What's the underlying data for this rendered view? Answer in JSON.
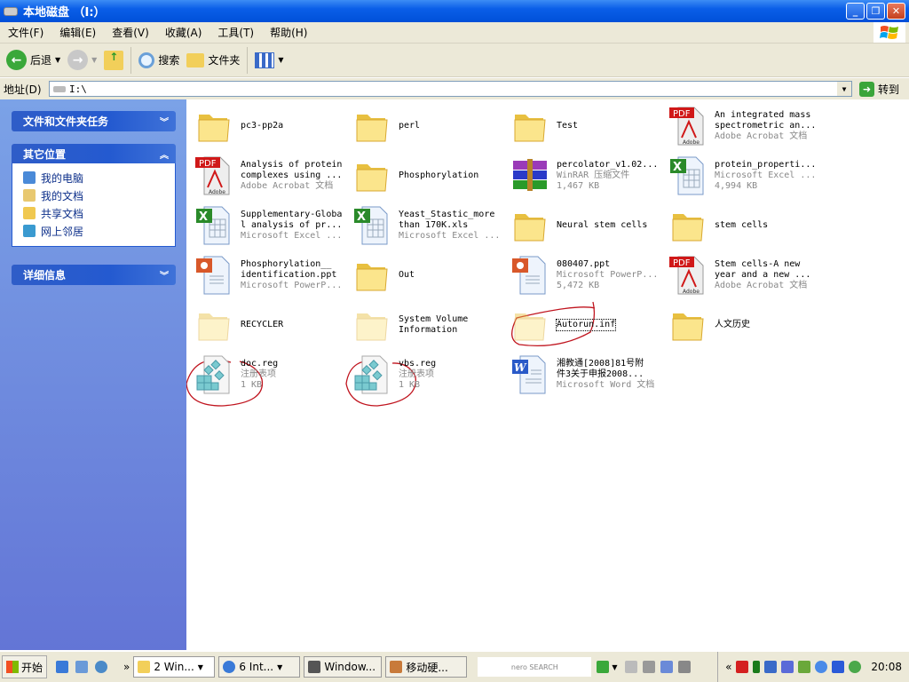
{
  "window": {
    "title": "本地磁盘 （I:）",
    "minimize": "_",
    "maximize": "❐",
    "close": "✕"
  },
  "menu": [
    "文件(F)",
    "编辑(E)",
    "查看(V)",
    "收藏(A)",
    "工具(T)",
    "帮助(H)"
  ],
  "toolbar": {
    "back": "后退",
    "search": "搜索",
    "folders": "文件夹"
  },
  "address": {
    "label": "地址(D)",
    "value": "I:\\",
    "go": "转到"
  },
  "sidebar": {
    "tasks_title": "文件和文件夹任务",
    "other_title": "其它位置",
    "other_items": [
      {
        "label": "我的电脑",
        "color": "#4a8ad8"
      },
      {
        "label": "我的文档",
        "color": "#e8c870"
      },
      {
        "label": "共享文档",
        "color": "#f0c850"
      },
      {
        "label": "网上邻居",
        "color": "#3a9ad0"
      }
    ],
    "details_title": "详细信息"
  },
  "files": [
    {
      "name": "pc3-pp2a",
      "icon": "folder"
    },
    {
      "name": "perl",
      "icon": "folder"
    },
    {
      "name": "Test",
      "icon": "folder"
    },
    {
      "name": "An integrated mass\nspectrometric an...",
      "type": "Adobe Acrobat 文档",
      "icon": "pdf"
    },
    {
      "name": "Analysis of protein\ncomplexes using ...",
      "type": "Adobe Acrobat 文档",
      "icon": "pdf"
    },
    {
      "name": "Phosphorylation",
      "icon": "folder"
    },
    {
      "name": "percolator_v1.02...",
      "type": "WinRAR 压缩文件",
      "size": "1,467 KB",
      "icon": "rar"
    },
    {
      "name": "protein_properti...",
      "type": "Microsoft Excel ...",
      "size": "4,994 KB",
      "icon": "excel"
    },
    {
      "name": "Supplementary-Globa\nl analysis of pr...",
      "type": "Microsoft Excel ...",
      "icon": "excel"
    },
    {
      "name": "Yeast_Stastic_more\nthan 170K.xls",
      "type": "Microsoft Excel ...",
      "icon": "excel"
    },
    {
      "name": "Neural stem cells",
      "icon": "folder"
    },
    {
      "name": "stem cells",
      "icon": "folder"
    },
    {
      "name": "Phosphorylation__\nidentification.ppt",
      "type": "Microsoft PowerP...",
      "icon": "ppt"
    },
    {
      "name": "Out",
      "icon": "folder"
    },
    {
      "name": "080407.ppt",
      "type": "Microsoft PowerP...",
      "size": "5,472 KB",
      "icon": "ppt"
    },
    {
      "name": "Stem cells-A new\nyear and a new ...",
      "type": "Adobe Acrobat 文档",
      "icon": "pdf"
    },
    {
      "name": "RECYCLER",
      "icon": "folder-hidden"
    },
    {
      "name": "System Volume\nInformation",
      "icon": "folder-hidden"
    },
    {
      "name": "Autorun.inf",
      "icon": "folder-hidden",
      "selected": true
    },
    {
      "name": "人文历史",
      "icon": "folder"
    },
    {
      "name": "doc.reg",
      "type": "注册表项",
      "size": "1 KB",
      "icon": "reg"
    },
    {
      "name": "vbs.reg",
      "type": "注册表项",
      "size": "1 KB",
      "icon": "reg"
    },
    {
      "name": "湘教通[2008]81号附\n件3关于申报2008...",
      "type": "Microsoft Word 文档",
      "icon": "word"
    }
  ],
  "taskbar": {
    "start": "开始",
    "buttons": [
      "2 Win...",
      "6 Int...",
      "Window...",
      "移动硬..."
    ],
    "search_brand": "nero SEARCH",
    "clock": "20:08"
  },
  "colors": {
    "title_blue": "#0a5ee8",
    "sidebar_blue": "#6f8fe0",
    "annotation_red": "#c0141e"
  }
}
